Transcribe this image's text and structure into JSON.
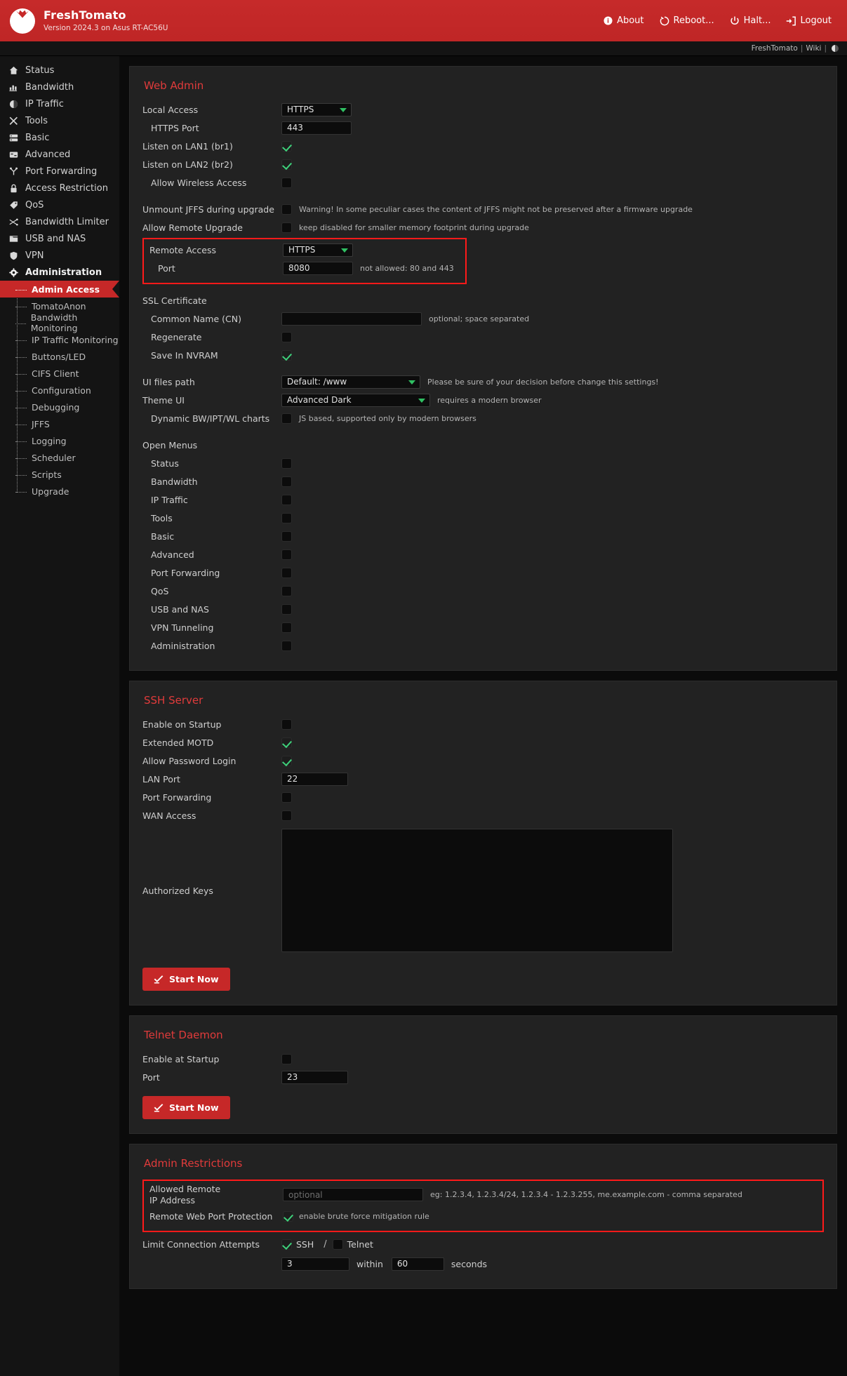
{
  "header": {
    "title": "FreshTomato",
    "subtitle": "Version 2024.3 on Asus RT-AC56U",
    "actions": [
      {
        "label": "About",
        "icon": "info-icon"
      },
      {
        "label": "Reboot...",
        "icon": "reboot-icon"
      },
      {
        "label": "Halt...",
        "icon": "power-icon"
      },
      {
        "label": "Logout",
        "icon": "logout-icon"
      }
    ]
  },
  "subbar": {
    "brand_link": "FreshTomato",
    "wiki_link": "Wiki",
    "sep": "|"
  },
  "sidebar": {
    "items": [
      {
        "label": "Status",
        "icon": "home-icon"
      },
      {
        "label": "Bandwidth",
        "icon": "bar-chart-icon"
      },
      {
        "label": "IP Traffic",
        "icon": "pie-chart-icon"
      },
      {
        "label": "Tools",
        "icon": "tools-icon"
      },
      {
        "label": "Basic",
        "icon": "server-icon"
      },
      {
        "label": "Advanced",
        "icon": "sliders-icon"
      },
      {
        "label": "Port Forwarding",
        "icon": "fork-icon"
      },
      {
        "label": "Access Restriction",
        "icon": "lock-icon"
      },
      {
        "label": "QoS",
        "icon": "tag-icon"
      },
      {
        "label": "Bandwidth Limiter",
        "icon": "limiter-icon"
      },
      {
        "label": "USB and NAS",
        "icon": "folder-icon"
      },
      {
        "label": "VPN",
        "icon": "shield-icon"
      },
      {
        "label": "Administration",
        "icon": "gear-icon"
      }
    ],
    "sub_items": [
      {
        "label": "Admin Access",
        "active": true
      },
      {
        "label": "TomatoAnon",
        "active": false
      },
      {
        "label": "Bandwidth Monitoring",
        "active": false
      },
      {
        "label": "IP Traffic Monitoring",
        "active": false
      },
      {
        "label": "Buttons/LED",
        "active": false
      },
      {
        "label": "CIFS Client",
        "active": false
      },
      {
        "label": "Configuration",
        "active": false
      },
      {
        "label": "Debugging",
        "active": false
      },
      {
        "label": "JFFS",
        "active": false
      },
      {
        "label": "Logging",
        "active": false
      },
      {
        "label": "Scheduler",
        "active": false
      },
      {
        "label": "Scripts",
        "active": false
      },
      {
        "label": "Upgrade",
        "active": false
      }
    ]
  },
  "web_admin": {
    "title": "Web Admin",
    "local_access_label": "Local Access",
    "local_access_value": "HTTPS",
    "https_port_label": "HTTPS Port",
    "https_port_value": "443",
    "listen_lan1_label": "Listen on LAN1 (br1)",
    "listen_lan1_checked": true,
    "listen_lan2_label": "Listen on LAN2 (br2)",
    "listen_lan2_checked": true,
    "allow_wireless_label": "Allow Wireless Access",
    "allow_wireless_checked": false,
    "unmount_jffs_label": "Unmount JFFS during upgrade",
    "unmount_jffs_checked": false,
    "unmount_jffs_hint": "Warning! In some peculiar cases the content of JFFS might not be preserved after a firmware upgrade",
    "allow_remote_upgrade_label": "Allow Remote Upgrade",
    "allow_remote_upgrade_checked": false,
    "allow_remote_upgrade_hint": "keep disabled for smaller memory footprint during upgrade",
    "remote_access_label": "Remote Access",
    "remote_access_value": "HTTPS",
    "remote_port_label": "Port",
    "remote_port_value": "8080",
    "remote_port_hint": "not allowed: 80 and 443",
    "ssl_cert_label": "SSL Certificate",
    "common_name_label": "Common Name (CN)",
    "common_name_value": "",
    "common_name_hint": "optional; space separated",
    "regenerate_label": "Regenerate",
    "regenerate_checked": false,
    "save_nvram_label": "Save In NVRAM",
    "save_nvram_checked": true,
    "ui_files_path_label": "UI files path",
    "ui_files_path_value": "Default: /www",
    "ui_files_path_hint": "Please be sure of your decision before change this settings!",
    "theme_ui_label": "Theme UI",
    "theme_ui_value": "Advanced Dark",
    "theme_ui_hint": "requires a modern browser",
    "dynamic_charts_label": "Dynamic BW/IPT/WL charts",
    "dynamic_charts_checked": false,
    "dynamic_charts_hint": "JS based, supported only by modern browsers",
    "open_menus_label": "Open Menus",
    "open_menus": [
      {
        "label": "Status",
        "checked": false
      },
      {
        "label": "Bandwidth",
        "checked": false
      },
      {
        "label": "IP Traffic",
        "checked": false
      },
      {
        "label": "Tools",
        "checked": false
      },
      {
        "label": "Basic",
        "checked": false
      },
      {
        "label": "Advanced",
        "checked": false
      },
      {
        "label": "Port Forwarding",
        "checked": false
      },
      {
        "label": "QoS",
        "checked": false
      },
      {
        "label": "USB and NAS",
        "checked": false
      },
      {
        "label": "VPN Tunneling",
        "checked": false
      },
      {
        "label": "Administration",
        "checked": false
      }
    ]
  },
  "ssh_server": {
    "title": "SSH Server",
    "enable_startup_label": "Enable on Startup",
    "enable_startup_checked": false,
    "extended_motd_label": "Extended MOTD",
    "extended_motd_checked": true,
    "allow_password_label": "Allow Password Login",
    "allow_password_checked": true,
    "lan_port_label": "LAN Port",
    "lan_port_value": "22",
    "port_forwarding_label": "Port Forwarding",
    "port_forwarding_checked": false,
    "wan_access_label": "WAN Access",
    "wan_access_checked": false,
    "authorized_keys_label": "Authorized Keys",
    "authorized_keys_value": "",
    "start_now_label": "Start Now"
  },
  "telnet": {
    "title": "Telnet Daemon",
    "enable_startup_label": "Enable at Startup",
    "enable_startup_checked": false,
    "port_label": "Port",
    "port_value": "23",
    "start_now_label": "Start Now"
  },
  "admin_restrictions": {
    "title": "Admin Restrictions",
    "allowed_remote_label_line1": "Allowed Remote",
    "allowed_remote_label_line2": "IP Address",
    "allowed_remote_placeholder": "optional",
    "allowed_remote_value": "",
    "allowed_remote_hint": "eg: 1.2.3.4, 1.2.3.4/24, 1.2.3.4 - 1.2.3.255, me.example.com - comma separated",
    "remote_web_port_label": "Remote Web Port Protection",
    "remote_web_port_checked": true,
    "remote_web_port_hint": "enable brute force mitigation rule",
    "limit_attempts_label": "Limit Connection Attempts",
    "ssh_label": "SSH",
    "ssh_checked": true,
    "separator": "/",
    "telnet_label": "Telnet",
    "telnet_checked": false,
    "attempts_value": "3",
    "within_label": "within",
    "seconds_value": "60",
    "seconds_label": "seconds"
  },
  "colors": {
    "accent": "#c62828",
    "highlight_border": "#ff1a1a",
    "check_green": "#3ed07a",
    "panel_bg": "#222222"
  }
}
